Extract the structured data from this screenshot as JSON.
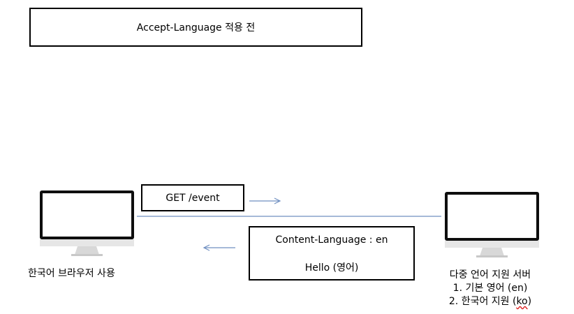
{
  "title": "Accept-Language 적용 전",
  "request": {
    "label": "GET /event"
  },
  "response": {
    "header_line": "Content-Language : en",
    "body_line": "Hello (영어)"
  },
  "client": {
    "label": "한국어 브라우저 사용"
  },
  "server": {
    "title": "다중 언어 지원 서버",
    "items": [
      {
        "text": "1.  기본 영어 (en)"
      },
      {
        "prefix": "2.  한국어 지원 (",
        "code": "ko",
        "suffix": ")"
      }
    ]
  },
  "colors": {
    "arrow": "#6f8fc1",
    "line": "#6f8fc1"
  }
}
